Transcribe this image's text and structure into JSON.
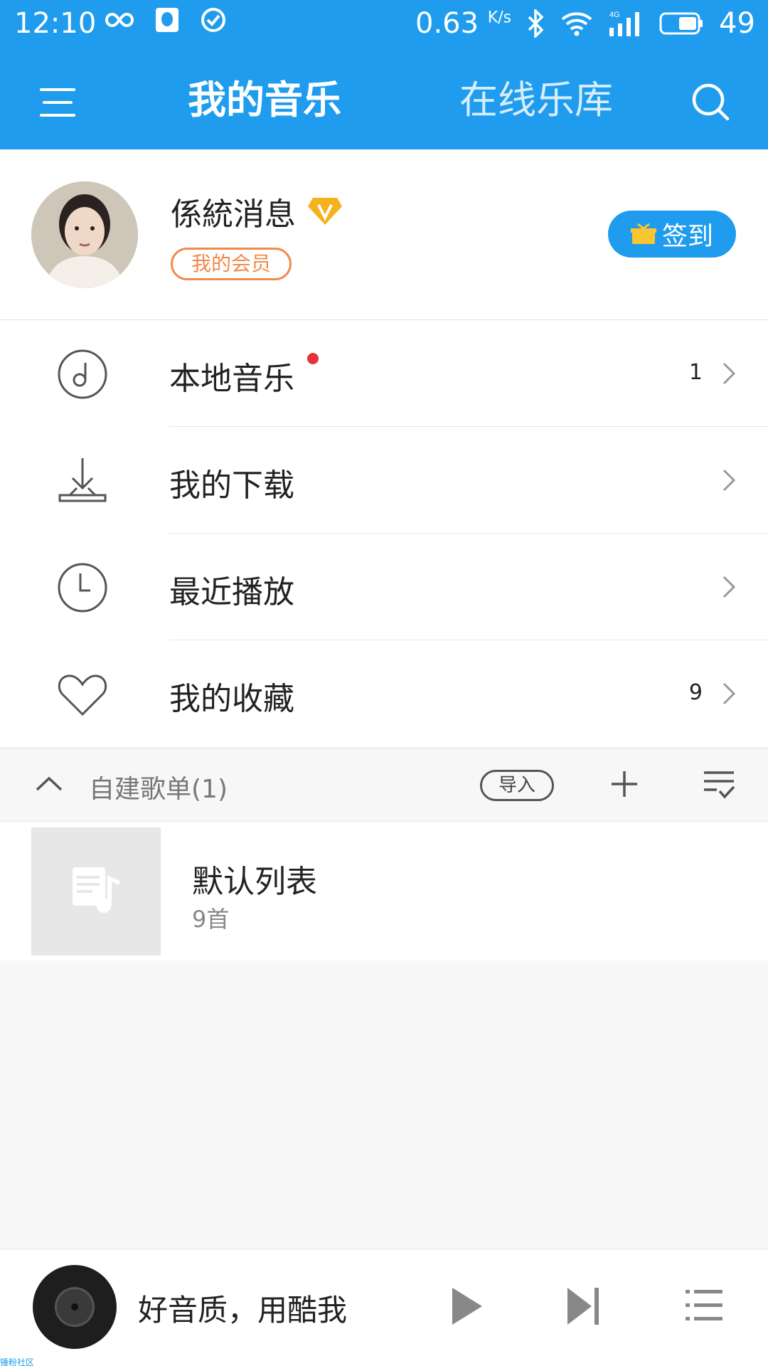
{
  "status_bar": {
    "time": "12:10",
    "speed": "0.63",
    "speed_unit": "K/s",
    "network": "4G",
    "battery": "49"
  },
  "header": {
    "tab_active": "我的音乐",
    "tab_inactive": "在线乐库"
  },
  "profile": {
    "username": "係統消息",
    "vip_label": "我的会员",
    "signin_label": "签到"
  },
  "menu": [
    {
      "label": "本地音乐",
      "count": "1",
      "icon": "music-note-icon",
      "has_dot": true
    },
    {
      "label": "我的下载",
      "count": "",
      "icon": "download-icon",
      "has_dot": false
    },
    {
      "label": "最近播放",
      "count": "",
      "icon": "clock-icon",
      "has_dot": false
    },
    {
      "label": "我的收藏",
      "count": "9",
      "icon": "heart-icon",
      "has_dot": false
    }
  ],
  "playlists": {
    "section_title": "自建歌单(1)",
    "import_label": "导入",
    "items": [
      {
        "name": "默认列表",
        "count": "9首"
      }
    ]
  },
  "player": {
    "song_text": "好音质，用酷我"
  },
  "watermark": "锤粉社区",
  "colors": {
    "primary": "#1f9ced",
    "vip_orange": "#f08a4b",
    "red_dot": "#e8323a"
  }
}
